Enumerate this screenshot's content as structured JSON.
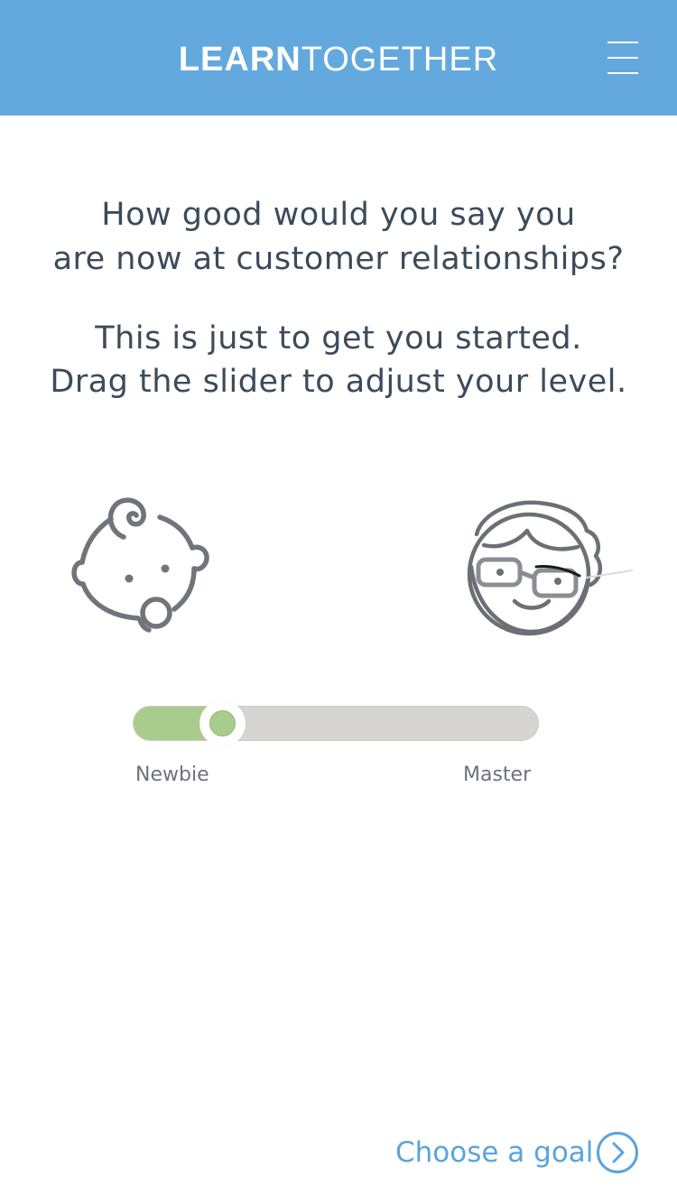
{
  "header": {
    "logo_bold": "LEARN",
    "logo_light": "TOGETHER",
    "menu_icon": "hamburger-menu-icon"
  },
  "question": {
    "line1": "How good would you say you",
    "line2": "are now at customer relationships?"
  },
  "hint": {
    "line1": "This is just to get you started.",
    "line2": "Drag the slider to adjust your level."
  },
  "icons": {
    "newbie": "baby-face-icon",
    "master": "bearded-glasses-face-icon"
  },
  "slider": {
    "value": 0.22,
    "min_label": "Newbie",
    "max_label": "Master"
  },
  "cta": {
    "label": "Choose a goal",
    "icon": "chevron-right-circle-icon"
  },
  "colors": {
    "header_bg": "#63a9de",
    "slider_fill": "#a9cc8c",
    "slider_track": "#d6d5d1",
    "text": "#3b4b5a",
    "link": "#5aa4db"
  }
}
